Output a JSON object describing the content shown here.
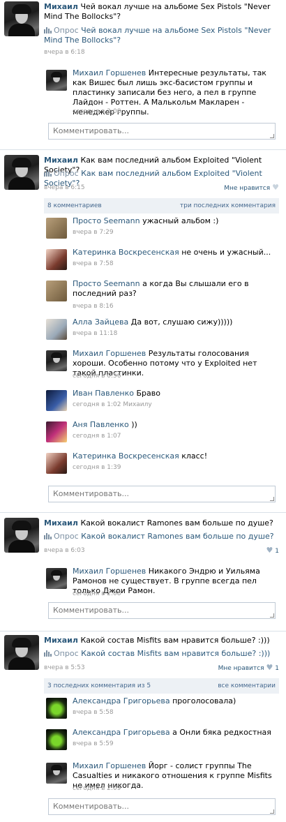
{
  "comment_placeholder": "Комментировать...",
  "poll_prefix": "Опрос",
  "like_label": "Мне нравится",
  "posts": [
    {
      "author": "Михаил",
      "text": "Чей вокал лучше на альбоме Sex Pistols \"Never Mind The Bollocks\"?",
      "poll": "Чей вокал лучше на альбоме Sex Pistols \"Never Mind The Bollocks\"?",
      "time": "вчера в 6:18",
      "comments": [
        {
          "name": "Михаил Горшенев",
          "text": "Интересные результаты, так как Вишес был лишь экс-басистом группы и пластинку записали без него, а пел в группе Лайдон - Роттен. А Малькольм Макларен - менеджер группы.",
          "time": "сегодня в 2:08"
        }
      ]
    },
    {
      "author": "Михаил",
      "text": "Как вам последний альбом Exploited \"Violent Society\"?",
      "poll": "Как вам последний альбом Exploited \"Violent Society\"?",
      "time": "вчера в 6:15",
      "likes": "",
      "comments_count": "8 комментариев",
      "comments_link": "три последних комментария",
      "comments": [
        {
          "name": "Просто Seemann",
          "text": "ужасный альбом :)",
          "time": "вчера в 7:29"
        },
        {
          "name": "Катеринка Воскресенская",
          "text": "не очень и ужасный...",
          "time": "вчера в 7:58"
        },
        {
          "name": "Просто Seemann",
          "text": "а когда Вы слышали его в последний раз?",
          "time": "вчера в 8:16"
        },
        {
          "name": "Алла Зайцева",
          "text": "Да вот, слушаю сижу)))))",
          "time": "вчера в 11:18"
        },
        {
          "name": "Михаил Горшенев",
          "text": "Результаты голосования хороши. Особенно потому что у Exploited нет такой пластинки.",
          "time": "сегодня в 0:56"
        },
        {
          "name": "Иван Павленко",
          "text": "Браво",
          "time": "сегодня в 1:02 Михаилу"
        },
        {
          "name": "Аня Павленко",
          "text": "))",
          "time": "сегодня в 1:07"
        },
        {
          "name": "Катеринка Воскресенская",
          "text": "класс!",
          "time": "сегодня в 1:39"
        }
      ]
    },
    {
      "author": "Михаил",
      "text": "Какой вокалист Ramones вам больше по душе?",
      "poll": "Какой вокалист Ramones вам больше по душе?",
      "time": "вчера в 6:03",
      "likes": "1",
      "comments": [
        {
          "name": "Михаил Горшенев",
          "text": "Никакого Эндрю и Уильяма Рамонов не существует. В группе всегда пел только Джои Рамон.",
          "time": "сегодня в 2:08"
        }
      ]
    },
    {
      "author": "Михаил",
      "text": "Какой состав Misfits вам нравится больше? :)))",
      "poll": "Какой состав Misfits вам нравится больше? :)))",
      "time": "вчера в 5:53",
      "likes": "1",
      "comments_count": "3 последних комментария из 5",
      "comments_link": "все комментарии",
      "comments": [
        {
          "name": "Александра Григорьева",
          "text": "проголосовала)",
          "time": "вчера в 5:58"
        },
        {
          "name": "Александра Григорьева",
          "text": "а Онли бяка редкостная",
          "time": "вчера в 5:59"
        },
        {
          "name": "Михаил Горшенев",
          "text": "Йорг - солист группы The Casualties и никакого отношения к группе Misfits не имел никогда.",
          "time": "сегодня в 2:09"
        }
      ]
    }
  ]
}
